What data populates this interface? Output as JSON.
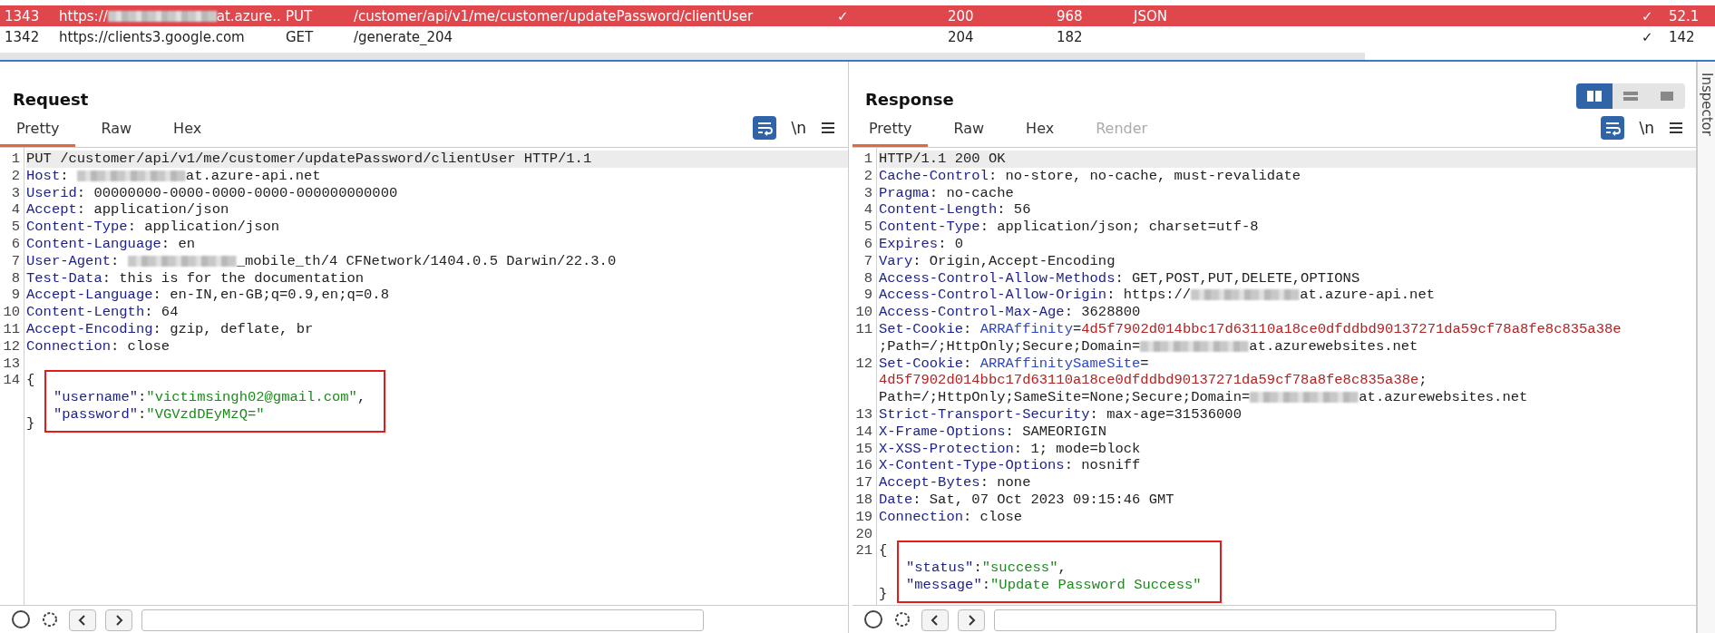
{
  "traffic_table": {
    "rows": [
      {
        "selected": true,
        "cells": [
          [
            {
              "kind": "text",
              "text": "1343"
            }
          ],
          [
            {
              "kind": "text",
              "text": "https://"
            },
            {
              "kind": "blur"
            },
            {
              "kind": "text",
              "text": "at.azure..."
            }
          ],
          [
            {
              "kind": "text",
              "text": "PUT"
            }
          ],
          [
            {
              "kind": "text",
              "text": "/customer/api/v1/me/customer/updatePassword/clientUser"
            }
          ],
          [
            {
              "kind": "text",
              "text": "✓"
            }
          ],
          [
            {
              "kind": "text",
              "text": "200"
            }
          ],
          [
            {
              "kind": "text",
              "text": "968"
            }
          ],
          [
            {
              "kind": "text",
              "text": "JSON"
            }
          ],
          [
            {
              "kind": "text",
              "text": "✓"
            }
          ],
          [
            {
              "kind": "text",
              "text": "52.1"
            }
          ]
        ]
      },
      {
        "selected": false,
        "cells": [
          [
            {
              "kind": "text",
              "text": "1342"
            }
          ],
          [
            {
              "kind": "text",
              "text": "https://clients3.google.com"
            }
          ],
          [
            {
              "kind": "text",
              "text": "GET"
            }
          ],
          [
            {
              "kind": "text",
              "text": "/generate_204"
            }
          ],
          [],
          [
            {
              "kind": "text",
              "text": "204"
            }
          ],
          [
            {
              "kind": "text",
              "text": "182"
            }
          ],
          [],
          [
            {
              "kind": "text",
              "text": "✓"
            }
          ],
          [
            {
              "kind": "text",
              "text": "142"
            }
          ]
        ]
      }
    ]
  },
  "layout_buttons": [
    {
      "kind": "columns",
      "selected": true
    },
    {
      "kind": "rows",
      "selected": false
    },
    {
      "kind": "single",
      "selected": false
    }
  ],
  "panels": [
    {
      "title": "Request",
      "newline_toggle": "\\n",
      "tabs": [
        {
          "label": "Pretty",
          "selected": true,
          "disabled": false
        },
        {
          "label": "Raw",
          "selected": false,
          "disabled": false
        },
        {
          "label": "Hex",
          "selected": false,
          "disabled": false
        }
      ],
      "lines": [
        {
          "number": "1",
          "current": true,
          "parts": [
            {
              "kind": "plain",
              "text": "PUT /customer/api/v1/me/customer/updatePassword/clientUser HTTP/1.1"
            }
          ]
        },
        {
          "number": "2",
          "current": false,
          "parts": [
            {
              "kind": "key",
              "text": "Host"
            },
            {
              "kind": "plain",
              "text": ": "
            },
            {
              "kind": "blur"
            },
            {
              "kind": "plain",
              "text": "at.azure-api.net"
            }
          ]
        },
        {
          "number": "3",
          "current": false,
          "parts": [
            {
              "kind": "key",
              "text": "Userid"
            },
            {
              "kind": "plain",
              "text": ": 00000000-0000-0000-0000-000000000000"
            }
          ]
        },
        {
          "number": "4",
          "current": false,
          "parts": [
            {
              "kind": "key",
              "text": "Accept"
            },
            {
              "kind": "plain",
              "text": ": application/json"
            }
          ]
        },
        {
          "number": "5",
          "current": false,
          "parts": [
            {
              "kind": "key",
              "text": "Content-Type"
            },
            {
              "kind": "plain",
              "text": ": application/json"
            }
          ]
        },
        {
          "number": "6",
          "current": false,
          "parts": [
            {
              "kind": "key",
              "text": "Content-Language"
            },
            {
              "kind": "plain",
              "text": ": en"
            }
          ]
        },
        {
          "number": "7",
          "current": false,
          "parts": [
            {
              "kind": "key",
              "text": "User-Agent"
            },
            {
              "kind": "plain",
              "text": ": "
            },
            {
              "kind": "blur"
            },
            {
              "kind": "plain",
              "text": "_mobile_th/4 CFNetwork/1404.0.5 Darwin/22.3.0"
            }
          ]
        },
        {
          "number": "8",
          "current": false,
          "parts": [
            {
              "kind": "key",
              "text": "Test-Data"
            },
            {
              "kind": "plain",
              "text": ": this is for the documentation"
            }
          ]
        },
        {
          "number": "9",
          "current": false,
          "parts": [
            {
              "kind": "key",
              "text": "Accept-Language"
            },
            {
              "kind": "plain",
              "text": ": en-IN,en-GB;q=0.9,en;q=0.8"
            }
          ]
        },
        {
          "number": "10",
          "current": false,
          "parts": [
            {
              "kind": "key",
              "text": "Content-Length"
            },
            {
              "kind": "plain",
              "text": ": 64"
            }
          ]
        },
        {
          "number": "11",
          "current": false,
          "parts": [
            {
              "kind": "key",
              "text": "Accept-Encoding"
            },
            {
              "kind": "plain",
              "text": ": gzip, deflate, br"
            }
          ]
        },
        {
          "number": "12",
          "current": false,
          "parts": [
            {
              "kind": "key",
              "text": "Connection"
            },
            {
              "kind": "plain",
              "text": ": close"
            }
          ]
        },
        {
          "number": "13",
          "current": false
        }
      ],
      "body": {
        "number": "14",
        "open": "{",
        "close": "}",
        "highlighted": true,
        "entries": [
          [
            {
              "kind": "json_key",
              "text": "\"username\""
            },
            {
              "kind": "plain",
              "text": ":"
            },
            {
              "kind": "json_string",
              "text": "\"victimsingh02@gmail.com\""
            },
            {
              "kind": "plain",
              "text": ","
            }
          ],
          [
            {
              "kind": "json_key",
              "text": "\"password\""
            },
            {
              "kind": "plain",
              "text": ":"
            },
            {
              "kind": "json_string",
              "text": "\"VGVzdDEyMzQ=\""
            }
          ]
        ]
      }
    },
    {
      "title": "Response",
      "newline_toggle": "\\n",
      "tabs": [
        {
          "label": "Pretty",
          "selected": true,
          "disabled": false
        },
        {
          "label": "Raw",
          "selected": false,
          "disabled": false
        },
        {
          "label": "Hex",
          "selected": false,
          "disabled": false
        },
        {
          "label": "Render",
          "selected": false,
          "disabled": true
        }
      ],
      "lines": [
        {
          "number": "1",
          "current": true,
          "parts": [
            {
              "kind": "plain",
              "text": "HTTP/1.1 200 OK"
            }
          ]
        },
        {
          "number": "2",
          "current": false,
          "parts": [
            {
              "kind": "key",
              "text": "Cache-Control"
            },
            {
              "kind": "plain",
              "text": ": no-store, no-cache, must-revalidate"
            }
          ]
        },
        {
          "number": "3",
          "current": false,
          "parts": [
            {
              "kind": "key",
              "text": "Pragma"
            },
            {
              "kind": "plain",
              "text": ": no-cache"
            }
          ]
        },
        {
          "number": "4",
          "current": false,
          "parts": [
            {
              "kind": "key",
              "text": "Content-Length"
            },
            {
              "kind": "plain",
              "text": ": 56"
            }
          ]
        },
        {
          "number": "5",
          "current": false,
          "parts": [
            {
              "kind": "key",
              "text": "Content-Type"
            },
            {
              "kind": "plain",
              "text": ": application/json; charset=utf-8"
            }
          ]
        },
        {
          "number": "6",
          "current": false,
          "parts": [
            {
              "kind": "key",
              "text": "Expires"
            },
            {
              "kind": "plain",
              "text": ": 0"
            }
          ]
        },
        {
          "number": "7",
          "current": false,
          "parts": [
            {
              "kind": "key",
              "text": "Vary"
            },
            {
              "kind": "plain",
              "text": ": Origin,Accept-Encoding"
            }
          ]
        },
        {
          "number": "8",
          "current": false,
          "parts": [
            {
              "kind": "key",
              "text": "Access-Control-Allow-Methods"
            },
            {
              "kind": "plain",
              "text": ": GET,POST,PUT,DELETE,OPTIONS"
            }
          ]
        },
        {
          "number": "9",
          "current": false,
          "parts": [
            {
              "kind": "key",
              "text": "Access-Control-Allow-Origin"
            },
            {
              "kind": "plain",
              "text": ": https://"
            },
            {
              "kind": "blur"
            },
            {
              "kind": "plain",
              "text": "at.azure-api.net"
            }
          ]
        },
        {
          "number": "10",
          "current": false,
          "parts": [
            {
              "kind": "key",
              "text": "Access-Control-Max-Age"
            },
            {
              "kind": "plain",
              "text": ": 3628800"
            }
          ]
        },
        {
          "number": "11",
          "current": false,
          "parts": [
            {
              "kind": "key",
              "text": "Set-Cookie"
            },
            {
              "kind": "plain",
              "text": ": "
            },
            {
              "kind": "cookie_name",
              "text": "ARRAffinity"
            },
            {
              "kind": "plain",
              "text": "="
            },
            {
              "kind": "cookie_value",
              "text": "4d5f7902d014bbc17d63110a18ce0dfddbd90137271da59cf78a8fe8c835a38e"
            },
            {
              "kind": "break"
            },
            {
              "kind": "plain",
              "text": ";Path=/;HttpOnly;Secure;Domain="
            },
            {
              "kind": "blur"
            },
            {
              "kind": "plain",
              "text": "at.azurewebsites.net"
            }
          ]
        },
        {
          "number": "12",
          "current": false,
          "parts": [
            {
              "kind": "key",
              "text": "Set-Cookie"
            },
            {
              "kind": "plain",
              "text": ": "
            },
            {
              "kind": "cookie_name",
              "text": "ARRAffinitySameSite"
            },
            {
              "kind": "plain",
              "text": "="
            },
            {
              "kind": "break"
            },
            {
              "kind": "cookie_value",
              "text": "4d5f7902d014bbc17d63110a18ce0dfddbd90137271da59cf78a8fe8c835a38e"
            },
            {
              "kind": "plain",
              "text": ";"
            },
            {
              "kind": "break"
            },
            {
              "kind": "plain",
              "text": "Path=/;HttpOnly;SameSite=None;Secure;Domain="
            },
            {
              "kind": "blur"
            },
            {
              "kind": "plain",
              "text": "at.azurewebsites.net"
            }
          ]
        },
        {
          "number": "13",
          "current": false,
          "parts": [
            {
              "kind": "key",
              "text": "Strict-Transport-Security"
            },
            {
              "kind": "plain",
              "text": ": max-age=31536000"
            }
          ]
        },
        {
          "number": "14",
          "current": false,
          "parts": [
            {
              "kind": "key",
              "text": "X-Frame-Options"
            },
            {
              "kind": "plain",
              "text": ": SAMEORIGIN"
            }
          ]
        },
        {
          "number": "15",
          "current": false,
          "parts": [
            {
              "kind": "key",
              "text": "X-XSS-Protection"
            },
            {
              "kind": "plain",
              "text": ": 1; mode=block"
            }
          ]
        },
        {
          "number": "16",
          "current": false,
          "parts": [
            {
              "kind": "key",
              "text": "X-Content-Type-Options"
            },
            {
              "kind": "plain",
              "text": ": nosniff"
            }
          ]
        },
        {
          "number": "17",
          "current": false,
          "parts": [
            {
              "kind": "key",
              "text": "Accept-Bytes"
            },
            {
              "kind": "plain",
              "text": ": none"
            }
          ]
        },
        {
          "number": "18",
          "current": false,
          "parts": [
            {
              "kind": "key",
              "text": "Date"
            },
            {
              "kind": "plain",
              "text": ": Sat, 07 Oct 2023 09:15:46 GMT"
            }
          ]
        },
        {
          "number": "19",
          "current": false,
          "parts": [
            {
              "kind": "key",
              "text": "Connection"
            },
            {
              "kind": "plain",
              "text": ": close"
            }
          ]
        },
        {
          "number": "20",
          "current": false
        }
      ],
      "body": {
        "number": "21",
        "open": "{",
        "close": "}",
        "highlighted": true,
        "entries": [
          [
            {
              "kind": "json_key",
              "text": "\"status\""
            },
            {
              "kind": "plain",
              "text": ":"
            },
            {
              "kind": "json_string",
              "text": "\"success\""
            },
            {
              "kind": "plain",
              "text": ","
            }
          ],
          [
            {
              "kind": "json_key",
              "text": "\"message\""
            },
            {
              "kind": "plain",
              "text": ":"
            },
            {
              "kind": "json_string",
              "text": "\"Update Password Success\""
            }
          ]
        ]
      }
    }
  ],
  "side_tab": {
    "label": "Inspector"
  }
}
